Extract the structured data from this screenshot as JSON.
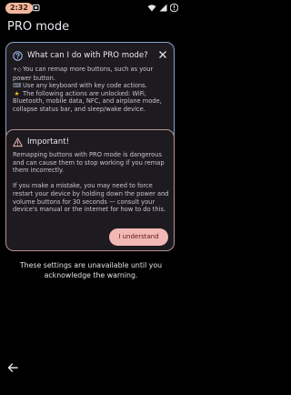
{
  "status_bar": {
    "time": "2:32"
  },
  "page": {
    "title": "PRO mode"
  },
  "info_card": {
    "title": "What can I do with PRO mode?",
    "lines": [
      "You can remap more buttons, such as your power button.",
      "Use any keyboard with key code actions.",
      "The following actions are unlocked: WiFi, Bluetooth, mobile data, NFC, and airplane mode, collapse status bar, and sleep/wake device."
    ]
  },
  "warning_card": {
    "title": "Important!",
    "paragraph_1": "Remapping buttons with PRO mode is dangerous and can cause them to stop working if you remap them incorrectly.",
    "paragraph_2": "If you make a mistake, you may need to force restart your device by holding down the power and volume buttons for 30 seconds — consult your device's manual or the internet for how to do this.",
    "button_label": "I understand"
  },
  "unavailable_message": "These settings are unavailable until you acknowledge the warning.",
  "icons": {
    "help": "help-circle-icon",
    "close": "close-icon",
    "warning": "warning-triangle-icon",
    "back": "arrow-back-icon",
    "remap": "remap-icon",
    "keyboard": "keyboard-icon",
    "star": "star-icon"
  },
  "colors": {
    "background": "#000000",
    "card": "#1d1b20",
    "info_border": "#8aa3c8",
    "warning_border": "#b89391",
    "button_fill": "#f2b8b5",
    "clock_pill": "#f3b89e"
  }
}
